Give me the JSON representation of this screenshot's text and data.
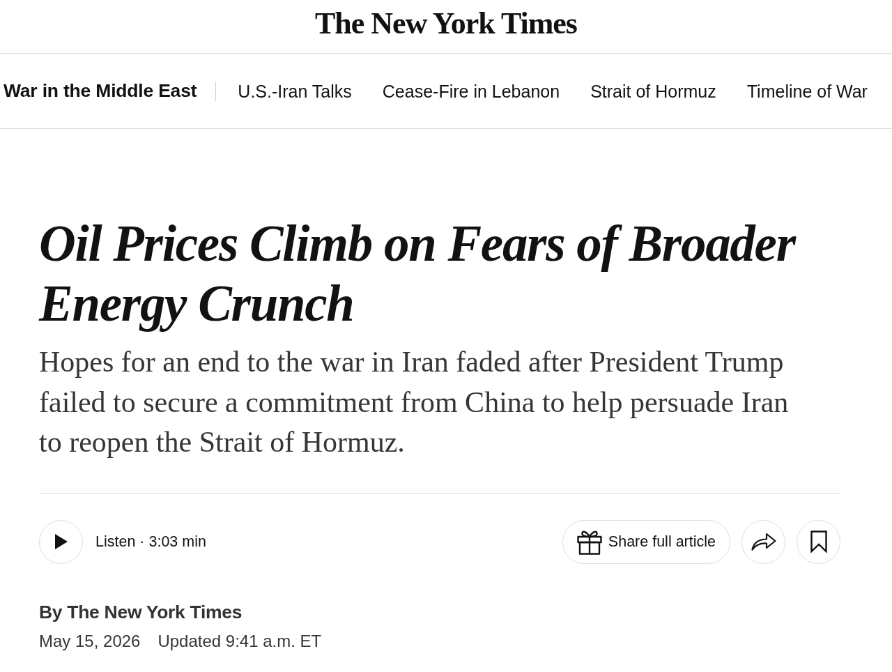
{
  "masthead": {
    "title": "The New York Times"
  },
  "section_nav": {
    "items": [
      {
        "label": "War in the Middle East",
        "kind": "section"
      },
      {
        "label": "U.S.-Iran Talks",
        "kind": "link"
      },
      {
        "label": "Cease-Fire in Lebanon",
        "kind": "link"
      },
      {
        "label": "Strait of Hormuz",
        "kind": "link"
      },
      {
        "label": "Timeline of War",
        "kind": "link"
      }
    ]
  },
  "article": {
    "headline": "Oil Prices Climb on Fears of Broader Energy Crunch",
    "summary": "Hopes for an end to the war in Iran faded after President Trump failed to secure a commitment from China to help persuade Iran to reopen the Strait of Hormuz.",
    "listen": {
      "label": "Listen · 3:03 min"
    },
    "share": {
      "label": "Share full article"
    },
    "byline": "By The New York Times",
    "date": "May 15, 2026",
    "updated": "Updated 9:41 a.m. ET"
  }
}
